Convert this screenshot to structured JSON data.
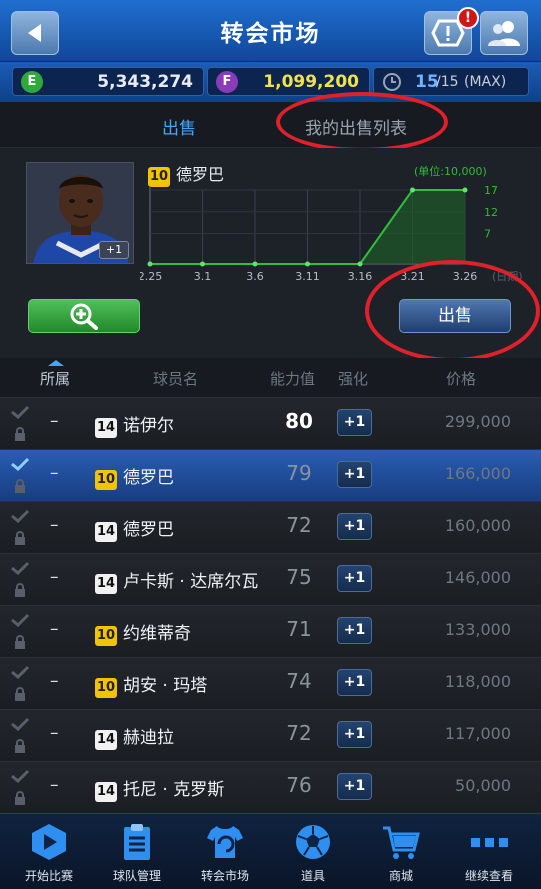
{
  "header": {
    "title": "转会市场",
    "alert_badge": "!"
  },
  "currency": {
    "e_label": "E",
    "e_value": "5,343,274",
    "f_label": "F",
    "f_value": "1,099,200",
    "stamina_current": "15",
    "stamina_max": "/15",
    "stamina_note": "(MAX)"
  },
  "tabs": {
    "sell": "出售",
    "my_list": "我的出售列表"
  },
  "player": {
    "level": "10",
    "name": "德罗巴",
    "boost": "+1",
    "unit_label": "(单位:10,000)",
    "sell_button": "出售"
  },
  "chart_data": {
    "type": "line",
    "title": "",
    "unit_label": "(单位:10,000)",
    "categories": [
      "2.25",
      "3.1",
      "3.6",
      "3.11",
      "3.16",
      "3.21",
      "3.26"
    ],
    "xlabel_suffix": "(日期)",
    "series": [
      {
        "values": [
          0,
          0,
          0,
          0,
          0,
          17,
          17
        ]
      }
    ],
    "y_ticks": [
      "17",
      "12",
      "7"
    ],
    "ylim": [
      0,
      17
    ],
    "color": "#2fbf3a",
    "grid": true
  },
  "columns": {
    "belong": "所属",
    "player": "球员名",
    "ability": "能力值",
    "boost": "强化",
    "price": "价格"
  },
  "rows": [
    {
      "dash": "–",
      "level": "14",
      "name": "诺伊尔",
      "rating": "80",
      "boost": "+1",
      "price": "299,000"
    },
    {
      "dash": "–",
      "level": "10",
      "name": "德罗巴",
      "rating": "79",
      "boost": "+1",
      "price": "166,000"
    },
    {
      "dash": "–",
      "level": "14",
      "name": "德罗巴",
      "rating": "72",
      "boost": "+1",
      "price": "160,000"
    },
    {
      "dash": "–",
      "level": "14",
      "name": "卢卡斯 · 达席尔瓦",
      "rating": "75",
      "boost": "+1",
      "price": "146,000"
    },
    {
      "dash": "–",
      "level": "10",
      "name": "约维蒂奇",
      "rating": "71",
      "boost": "+1",
      "price": "133,000"
    },
    {
      "dash": "–",
      "level": "10",
      "name": "胡安 · 玛塔",
      "rating": "74",
      "boost": "+1",
      "price": "118,000"
    },
    {
      "dash": "–",
      "level": "14",
      "name": "赫迪拉",
      "rating": "72",
      "boost": "+1",
      "price": "117,000"
    },
    {
      "dash": "–",
      "level": "14",
      "name": "托尼 · 克罗斯",
      "rating": "76",
      "boost": "+1",
      "price": "50,000"
    }
  ],
  "nav": [
    {
      "label": "开始比赛",
      "icon": "play-icon"
    },
    {
      "label": "球队管理",
      "icon": "clipboard-icon"
    },
    {
      "label": "转会市场",
      "icon": "jersey-icon"
    },
    {
      "label": "道具",
      "icon": "soccer-ball-icon"
    },
    {
      "label": "商城",
      "icon": "cart-icon"
    },
    {
      "label": "继续查看",
      "icon": "more-icon"
    }
  ]
}
